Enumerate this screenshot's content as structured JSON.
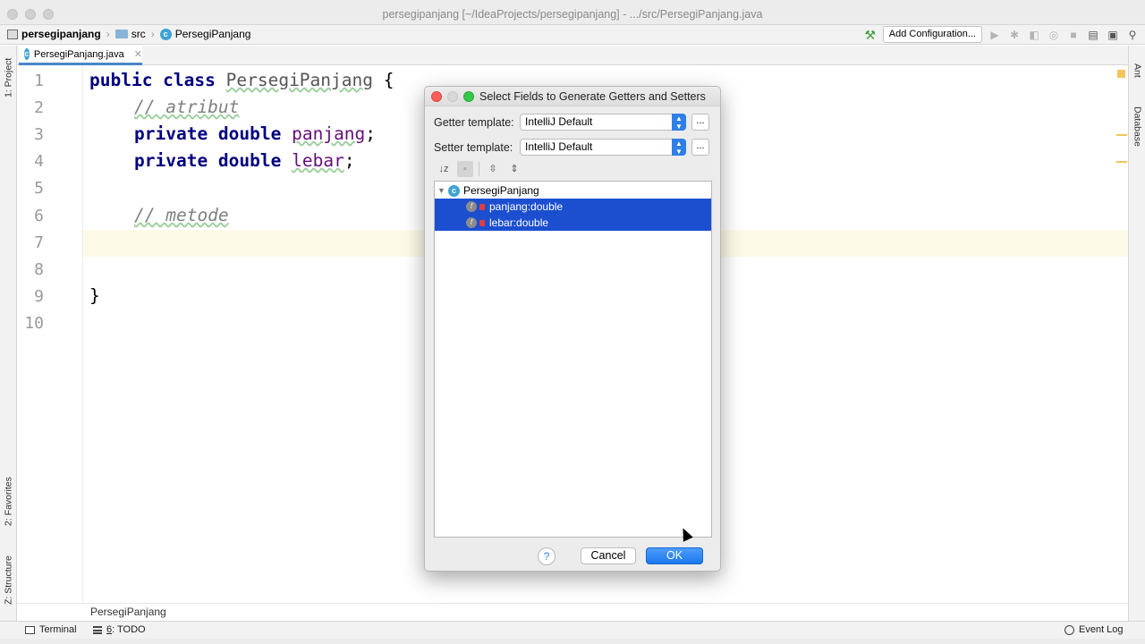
{
  "window": {
    "title": "persegipanjang [~/IdeaProjects/persegipanjang] - .../src/PersegiPanjang.java"
  },
  "navbar": {
    "crumbs": [
      "persegipanjang",
      "src",
      "PersegiPanjang"
    ],
    "add_configuration": "Add Configuration..."
  },
  "left_tabs": {
    "project": "1: Project",
    "favorites": "2: Favorites",
    "structure": "Z: Structure"
  },
  "right_tabs": {
    "ant": "Ant",
    "database": "Database"
  },
  "editor": {
    "tab_label": "PersegiPanjang.java",
    "line_numbers": [
      "1",
      "2",
      "3",
      "4",
      "5",
      "6",
      "7",
      "8",
      "9",
      "10"
    ],
    "code": {
      "l1_kw": "public class ",
      "l1_cls": "PersegiPanjang",
      "l1_rest": " {",
      "l2_comment": "// atribut",
      "l3_kw": "private double ",
      "l3_field": "panjang",
      "l3_rest": ";",
      "l4_kw": "private double ",
      "l4_field": "lebar",
      "l4_rest": ";",
      "l6_comment": "// metode",
      "l9": "}"
    },
    "breadcrumb_bottom": "PersegiPanjang"
  },
  "dialog": {
    "title": "Select Fields to Generate Getters and Setters",
    "getter_label": "Getter template:",
    "getter_value": "IntelliJ Default",
    "setter_label": "Setter template:",
    "setter_value": "IntelliJ Default",
    "more_label": "...",
    "tree": {
      "root": "PersegiPanjang",
      "items": [
        {
          "label": "panjang:double",
          "selected": true
        },
        {
          "label": "lebar:double",
          "selected": true
        }
      ]
    },
    "help_label": "?",
    "cancel_label": "Cancel",
    "ok_label": "OK"
  },
  "bottombar": {
    "terminal": "Terminal",
    "todo_num": "6",
    "todo_label": ": TODO",
    "event_log": "Event Log"
  },
  "colors": {
    "selection": "#1c4fd0",
    "accent_blue": "#2f7fe8",
    "keyword": "#000080",
    "field": "#660e7a",
    "comment": "#808080"
  }
}
